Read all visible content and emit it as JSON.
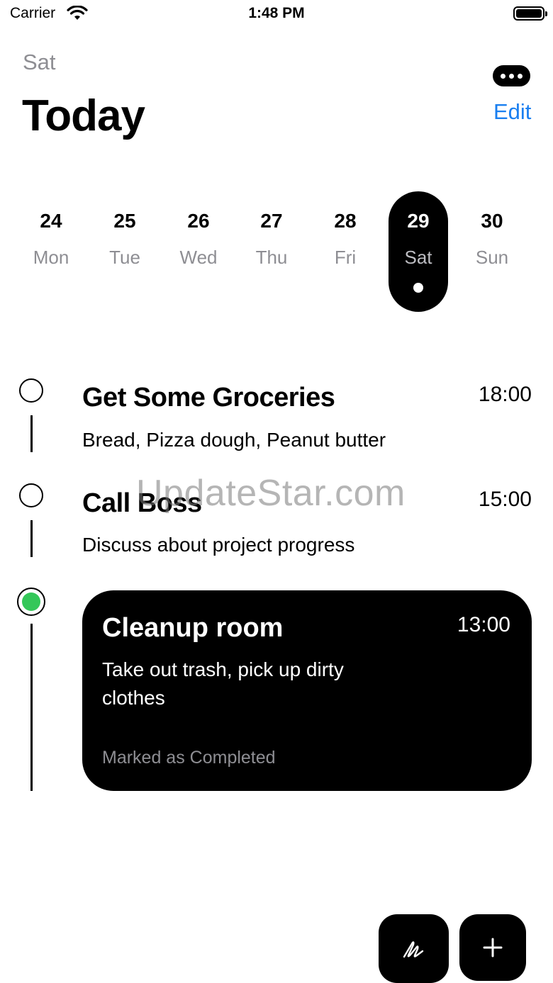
{
  "status_bar": {
    "carrier": "Carrier",
    "time": "1:48 PM"
  },
  "header": {
    "day": "Sat",
    "title": "Today",
    "edit_label": "Edit"
  },
  "week": [
    {
      "num": "24",
      "name": "Mon"
    },
    {
      "num": "25",
      "name": "Tue"
    },
    {
      "num": "26",
      "name": "Wed"
    },
    {
      "num": "27",
      "name": "Thu"
    },
    {
      "num": "28",
      "name": "Fri"
    },
    {
      "num": "29",
      "name": "Sat",
      "selected": true
    },
    {
      "num": "30",
      "name": "Sun"
    }
  ],
  "tasks": [
    {
      "title": "Get Some Groceries",
      "description": "Bread, Pizza dough, Peanut butter",
      "time": "18:00",
      "completed": false
    },
    {
      "title": "Call Boss",
      "description": "Discuss about project progress",
      "time": "15:00",
      "completed": false
    },
    {
      "title": "Cleanup room",
      "description": "Take out trash, pick up dirty clothes",
      "time": "13:00",
      "completed": true,
      "status": "Marked as Completed"
    }
  ],
  "watermark": "UpdateStar.com",
  "colors": {
    "accent": "#1a7ff0",
    "completed": "#34c759",
    "dark": "#000000",
    "muted": "#8e8e93"
  },
  "icons": {
    "more": "ellipsis-icon",
    "draw": "scribble-icon",
    "add": "plus-icon"
  }
}
